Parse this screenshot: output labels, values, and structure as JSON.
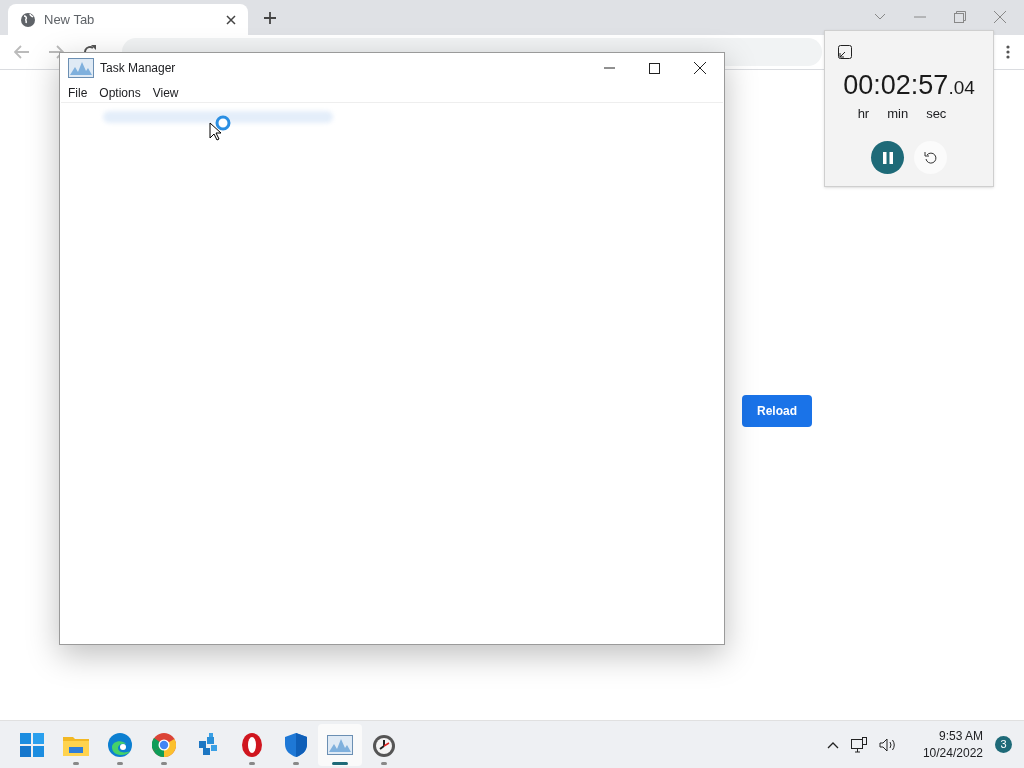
{
  "browser": {
    "tab": {
      "title": "New Tab"
    },
    "reload_button": "Reload"
  },
  "task_manager": {
    "title": "Task Manager",
    "menu": [
      "File",
      "Options",
      "View"
    ]
  },
  "timer": {
    "hours": "00",
    "sep1": ":",
    "minutes": "02",
    "sep2": ":",
    "seconds": "57",
    "fraction": ".04",
    "units": [
      "hr",
      "min",
      "sec"
    ],
    "running": true
  },
  "taskbar": {
    "apps": [
      {
        "kind": "start",
        "running": false,
        "selected": false
      },
      {
        "kind": "folder",
        "running": true,
        "selected": false
      },
      {
        "kind": "edge",
        "running": true,
        "selected": false
      },
      {
        "kind": "chrome",
        "running": true,
        "selected": false
      },
      {
        "kind": "cubes",
        "running": false,
        "selected": false
      },
      {
        "kind": "opera",
        "running": true,
        "selected": false
      },
      {
        "kind": "shield",
        "running": true,
        "selected": false
      },
      {
        "kind": "monitor",
        "running": true,
        "selected": true
      },
      {
        "kind": "clock",
        "running": true,
        "selected": false
      }
    ],
    "time": "9:53 AM",
    "date": "10/24/2022",
    "notifications": "3"
  }
}
